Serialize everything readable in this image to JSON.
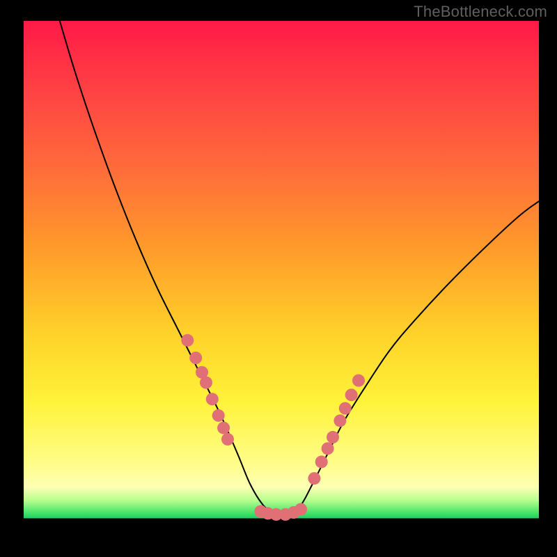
{
  "watermark": "TheBottleneck.com",
  "chart_data": {
    "type": "line",
    "title": "",
    "xlabel": "",
    "ylabel": "",
    "xlim": [
      0,
      100
    ],
    "ylim": [
      0,
      100
    ],
    "grid": false,
    "legend": false,
    "gradient_stops": [
      {
        "pct": 0,
        "color": "#ff1a46"
      },
      {
        "pct": 11,
        "color": "#ff3a44"
      },
      {
        "pct": 28,
        "color": "#ff6a3b"
      },
      {
        "pct": 44,
        "color": "#ff9a2a"
      },
      {
        "pct": 60,
        "color": "#ffd029"
      },
      {
        "pct": 74,
        "color": "#fff33a"
      },
      {
        "pct": 86,
        "color": "#fffd8a"
      },
      {
        "pct": 90.5,
        "color": "#fdffb4"
      },
      {
        "pct": 93.0,
        "color": "#b8ff8f"
      },
      {
        "pct": 95.5,
        "color": "#46e46a"
      },
      {
        "pct": 96.5,
        "color": "#1ecf62"
      },
      {
        "pct": 96.6,
        "color": "#000000"
      },
      {
        "pct": 100,
        "color": "#000000"
      }
    ],
    "series": [
      {
        "name": "bottleneck-curve",
        "color": "#000000",
        "stroke_width": 2,
        "x": [
          7.0,
          10.0,
          14.0,
          18.0,
          22.0,
          26.0,
          30.0,
          34.0,
          38.0,
          41.5,
          44.0,
          46.5,
          49.0,
          51.5,
          53.8,
          56.0,
          59.0,
          62.0,
          66.0,
          71.0,
          76.0,
          82.0,
          89.0,
          96.0,
          100.0
        ],
        "y": [
          100.0,
          90.0,
          78.0,
          67.0,
          57.0,
          48.0,
          40.0,
          32.0,
          24.0,
          16.0,
          10.0,
          6.0,
          4.0,
          4.0,
          6.0,
          10.0,
          16.0,
          22.0,
          28.5,
          36.0,
          42.0,
          48.5,
          55.5,
          62.0,
          65.0
        ]
      },
      {
        "name": "left-marker-cluster",
        "type": "scatter",
        "color": "#e17076",
        "radius": 9,
        "x": [
          31.8,
          33.4,
          34.6,
          35.4,
          36.6,
          37.8,
          38.8,
          39.6
        ],
        "y": [
          38.0,
          34.6,
          31.8,
          29.8,
          26.6,
          23.4,
          21.0,
          18.8
        ]
      },
      {
        "name": "right-marker-cluster",
        "type": "scatter",
        "color": "#e17076",
        "radius": 9,
        "x": [
          56.4,
          57.8,
          59.0,
          60.0,
          61.4,
          62.4,
          63.6,
          65.0
        ],
        "y": [
          11.2,
          14.4,
          17.0,
          19.2,
          22.4,
          24.8,
          27.4,
          30.2
        ]
      },
      {
        "name": "bottom-marker-cluster",
        "type": "scatter",
        "color": "#e17076",
        "radius": 9,
        "x": [
          46.0,
          47.4,
          49.0,
          50.8,
          52.4,
          53.8
        ],
        "y": [
          4.8,
          4.4,
          4.2,
          4.2,
          4.6,
          5.2
        ]
      }
    ]
  }
}
